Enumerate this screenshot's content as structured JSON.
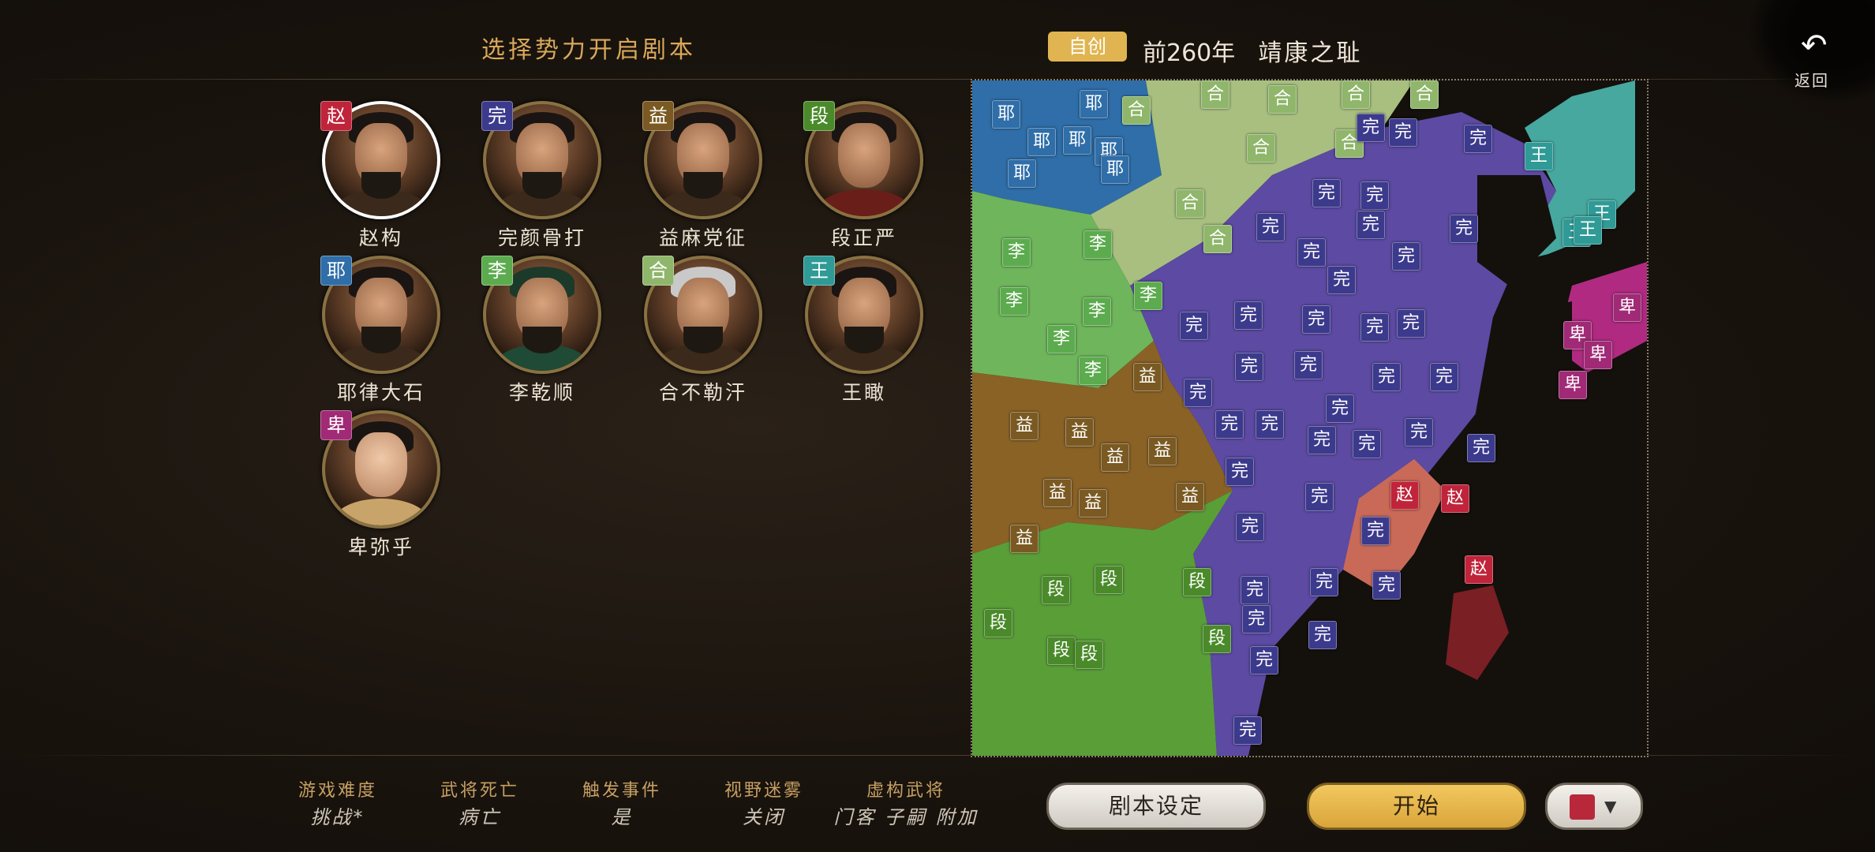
{
  "header": {
    "title": "选择势力开启剧本",
    "tag": "自创",
    "year": "前260年",
    "scenario": "靖康之耻"
  },
  "back": {
    "label": "返回",
    "icon": "undo-arrow-icon"
  },
  "colors": {
    "zhao": "#c0243a",
    "wanyan": "#3c3a8c",
    "yi": "#7a5a22",
    "duan": "#4a8a2a",
    "yelu": "#2f6ea8",
    "li": "#5cab4e",
    "he": "#8fb66a",
    "wang": "#2f9a96",
    "bi": "#a02a75"
  },
  "portraits": [
    {
      "name": "赵构",
      "badge": "赵",
      "color": "#c0243a",
      "selected": true
    },
    {
      "name": "完颜骨打",
      "badge": "完",
      "color": "#3c3a8c"
    },
    {
      "name": "益麻党征",
      "badge": "益",
      "color": "#7a5a22"
    },
    {
      "name": "段正严",
      "badge": "段",
      "color": "#4a8a2a"
    },
    {
      "name": "耶律大石",
      "badge": "耶",
      "color": "#2f6ea8"
    },
    {
      "name": "李乾顺",
      "badge": "李",
      "color": "#5cab4e"
    },
    {
      "name": "合不勒汗",
      "badge": "合",
      "color": "#8fb66a"
    },
    {
      "name": "王瞰",
      "badge": "王",
      "color": "#2f9a96"
    },
    {
      "name": "卑弥乎",
      "badge": "卑",
      "color": "#a02a75"
    }
  ],
  "map": {
    "markers": {
      "zhao": "赵",
      "wanyan": "完",
      "yi": "益",
      "duan": "段",
      "yelu": "耶",
      "li": "李",
      "he": "合",
      "wang": "王",
      "bi": "卑"
    }
  },
  "options": [
    {
      "label": "游戏难度",
      "value": "挑战*"
    },
    {
      "label": "武将死亡",
      "value": "病亡"
    },
    {
      "label": "触发事件",
      "value": "是"
    },
    {
      "label": "视野迷雾",
      "value": "关闭"
    },
    {
      "label": "虚构武将",
      "value": "门客 子嗣 附加"
    }
  ],
  "buttons": {
    "setting": "剧本设定",
    "start": "开始",
    "color": "#b8283a"
  }
}
